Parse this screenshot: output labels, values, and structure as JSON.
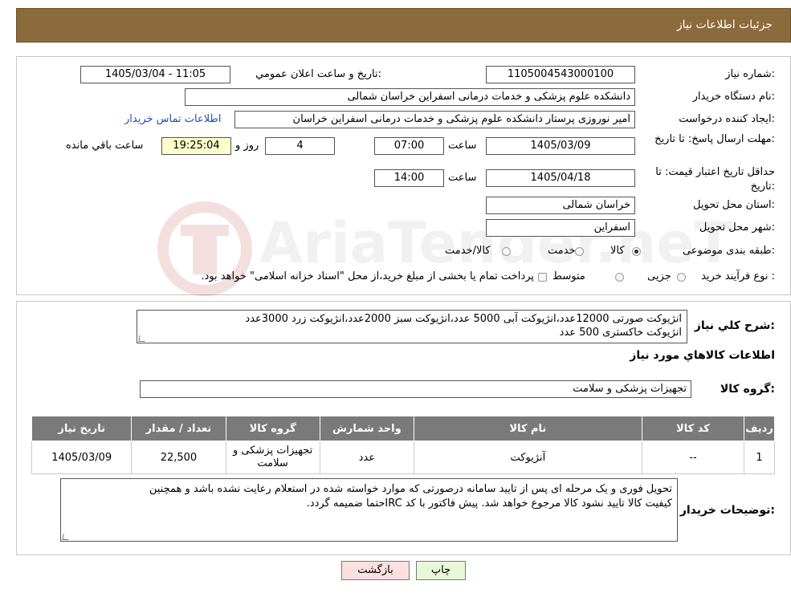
{
  "header": {
    "title": "جزئیات اطلاعات نیاز"
  },
  "labels": {
    "need_number": "شماره نیاز:",
    "announce_datetime": "تاريخ و ساعت اعلان عمومي:",
    "buyer_org": "نام دستگاه خریدار:",
    "requester": "ایجاد کننده درخواست:",
    "reply_deadline": "مهلت ارسال پاسخ: تا تاریخ:",
    "min_validity": "حداقل تاریخ اعتبار قیمت: تا تاریخ:",
    "time": "ساعت",
    "day_and": "روز و",
    "remaining": "ساعت باقي مانده",
    "delivery_province": "استان محل تحویل:",
    "delivery_city": "شهر محل تحویل:",
    "category": "طبقه بندی موضوعی:",
    "purchase_type": "نوع فرآیند خرید :",
    "general_desc": "شرح کلي نياز:",
    "goods_info": "اطلاعات کالاهاي مورد نياز",
    "goods_group": "گروه کالا:",
    "buyer_notes": "توضیحات خریدار:"
  },
  "fields": {
    "need_number": "1105004543000100",
    "announce_datetime": "1405/03/04 - 11:05",
    "buyer_org": "دانشکده علوم پزشکی و خدمات درمانی اسفراین خراسان شمالی",
    "requester": "امیر  نوروزی  پرستار  دانشکده علوم پزشکی و خدمات درمانی اسفراین خراسان",
    "contact_link": "اطلاعات تماس خریدار",
    "reply_date": "1405/03/09",
    "reply_time": "07:00",
    "reply_days": "4",
    "reply_remaining": "19:25:04",
    "validity_date": "1405/04/18",
    "validity_time": "14:00",
    "delivery_province": "خراسان شمالی",
    "delivery_city": "اسفراین",
    "general_desc_line1": "انژیوکت صورتی 12000عدد،انژیوکت آبی 5000 عدد،انژیوکت سبز 2000عدد،انژیوکت زرد 3000عدد",
    "general_desc_line2": "انژیوکت خاکستری 500 عدد",
    "goods_group": "تجهیزات پزشکی و سلامت",
    "buyer_notes_line1": "تحویل فوری و یک مرحله ای پس از تایید سامانه درصورتی که موارد خواسته شده در استعلام رعایت نشده باشد و همچنین",
    "buyer_notes_line2": "کیفیت کالا تایید نشود کالا مرجوع خواهد شد. پیش فاکتور با کد IRCحتما ضمیمه گردد."
  },
  "category_options": {
    "goods": "کالا",
    "service": "خدمت",
    "goods_service": "کالا/خدمت",
    "selected": "goods"
  },
  "purchase_options": {
    "minor": "جزیی",
    "medium": "متوسط",
    "note": "پرداخت تمام یا بخشی از مبلغ خرید،از محل \"اسناد خزانه اسلامی\" خواهد بود."
  },
  "table": {
    "headers": {
      "row": "ردیف",
      "code": "کد کالا",
      "name": "نام کالا",
      "unit": "واحد شمارش",
      "group": "گروه کالا",
      "qty": "تعداد / مقدار",
      "date": "تاریخ نیاز"
    },
    "rows": [
      {
        "row": "1",
        "code": "--",
        "name": "آنژیوکت",
        "unit": "عدد",
        "group": "تجهیزات پزشکی و سلامت",
        "qty": "22,500",
        "date": "1405/03/09"
      }
    ]
  },
  "buttons": {
    "print": "چاپ",
    "back": "بازگشت"
  },
  "watermark": {
    "text": "AriaTender.neT"
  },
  "colors": {
    "header_bg": "#8b6b3c",
    "table_header_bg": "#7a7a7a",
    "print_btn": "#e8f7d8",
    "back_btn": "#fbe0e0",
    "remaining_bg": "#ffffcc",
    "link": "#1a4fb5"
  }
}
